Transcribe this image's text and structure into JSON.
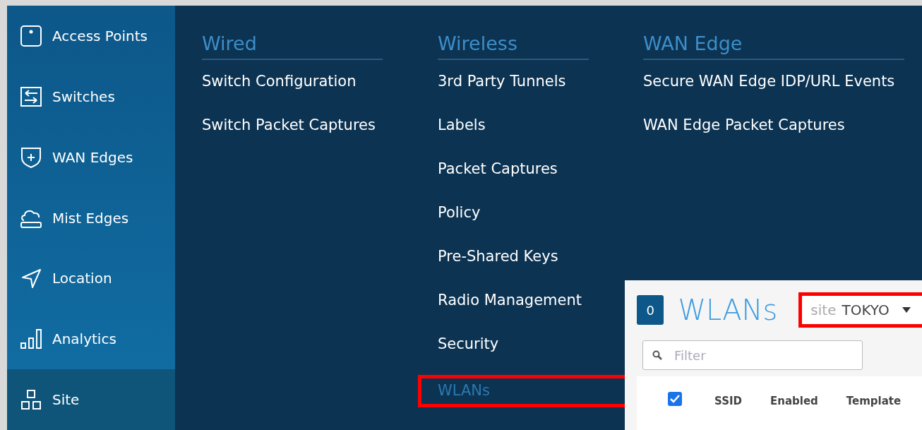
{
  "sidebar": {
    "items": [
      {
        "label": "Access Points",
        "selected": false
      },
      {
        "label": "Switches",
        "selected": false
      },
      {
        "label": "WAN Edges",
        "selected": false
      },
      {
        "label": "Mist Edges",
        "selected": false
      },
      {
        "label": "Location",
        "selected": false
      },
      {
        "label": "Analytics",
        "selected": false
      },
      {
        "label": "Site",
        "selected": true
      }
    ]
  },
  "menu": {
    "columns": [
      {
        "heading": "Wired",
        "items": [
          {
            "label": "Switch Configuration",
            "selected": false,
            "annotated": false
          },
          {
            "label": "Switch Packet Captures",
            "selected": false,
            "annotated": false
          }
        ]
      },
      {
        "heading": "Wireless",
        "items": [
          {
            "label": "3rd Party Tunnels",
            "selected": false,
            "annotated": false
          },
          {
            "label": "Labels",
            "selected": false,
            "annotated": false
          },
          {
            "label": "Packet Captures",
            "selected": false,
            "annotated": false
          },
          {
            "label": "Policy",
            "selected": false,
            "annotated": false
          },
          {
            "label": "Pre-Shared Keys",
            "selected": false,
            "annotated": false
          },
          {
            "label": "Radio Management",
            "selected": false,
            "annotated": false
          },
          {
            "label": "Security",
            "selected": false,
            "annotated": false
          },
          {
            "label": "WLANs",
            "selected": true,
            "annotated": true
          }
        ]
      },
      {
        "heading": "WAN Edge",
        "items": [
          {
            "label": "Secure WAN Edge IDP/URL Events",
            "selected": false,
            "annotated": false
          },
          {
            "label": "WAN Edge Packet Captures",
            "selected": false,
            "annotated": false
          }
        ]
      }
    ]
  },
  "wlans_panel": {
    "count": "0",
    "title": "WLANs",
    "site_selector": {
      "label": "site",
      "value": "TOKYO",
      "annotated": true
    },
    "filter": {
      "placeholder": "Filter"
    },
    "table": {
      "select_all_checked": true,
      "columns": [
        "SSID",
        "Enabled",
        "Template"
      ]
    }
  }
}
